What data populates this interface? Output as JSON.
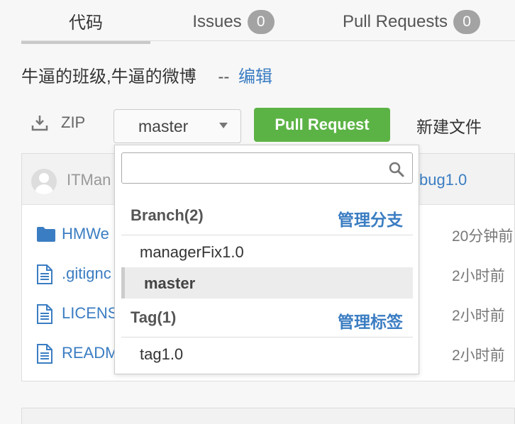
{
  "tabs": [
    {
      "label": "代码",
      "badge": null,
      "active": true
    },
    {
      "label": "Issues",
      "badge": "0",
      "active": false
    },
    {
      "label": "Pull Requests",
      "badge": "0",
      "active": false
    }
  ],
  "repo": {
    "description": "牛逼的班级,牛逼的微博",
    "separator": "--",
    "edit_label": "编辑"
  },
  "toolbar": {
    "zip_label": "ZIP",
    "branch_value": "master",
    "pull_request_label": "Pull Request",
    "new_file_label": "新建文件"
  },
  "commit": {
    "author": "ITMan",
    "message": "bug1.0"
  },
  "files": [
    {
      "icon": "folder-icon",
      "name": "HMWe",
      "time": "20分钟前"
    },
    {
      "icon": "file-icon",
      "name": ".gitignc",
      "time": "2小时前"
    },
    {
      "icon": "file-icon",
      "name": "LICENS",
      "time": "2小时前"
    },
    {
      "icon": "file-icon",
      "name": "READM",
      "time": "2小时前"
    }
  ],
  "dropdown": {
    "search_placeholder": "",
    "branch_header": "Branch(2)",
    "branch_manage": "管理分支",
    "branches": [
      "managerFix1.0",
      "master"
    ],
    "selected_branch": "master",
    "tag_header": "Tag(1)",
    "tag_manage": "管理标签",
    "tags": [
      "tag1.0"
    ]
  },
  "colors": {
    "link": "#3b7dc2",
    "primary_button": "#5cb345",
    "badge": "#a3a3a3"
  }
}
